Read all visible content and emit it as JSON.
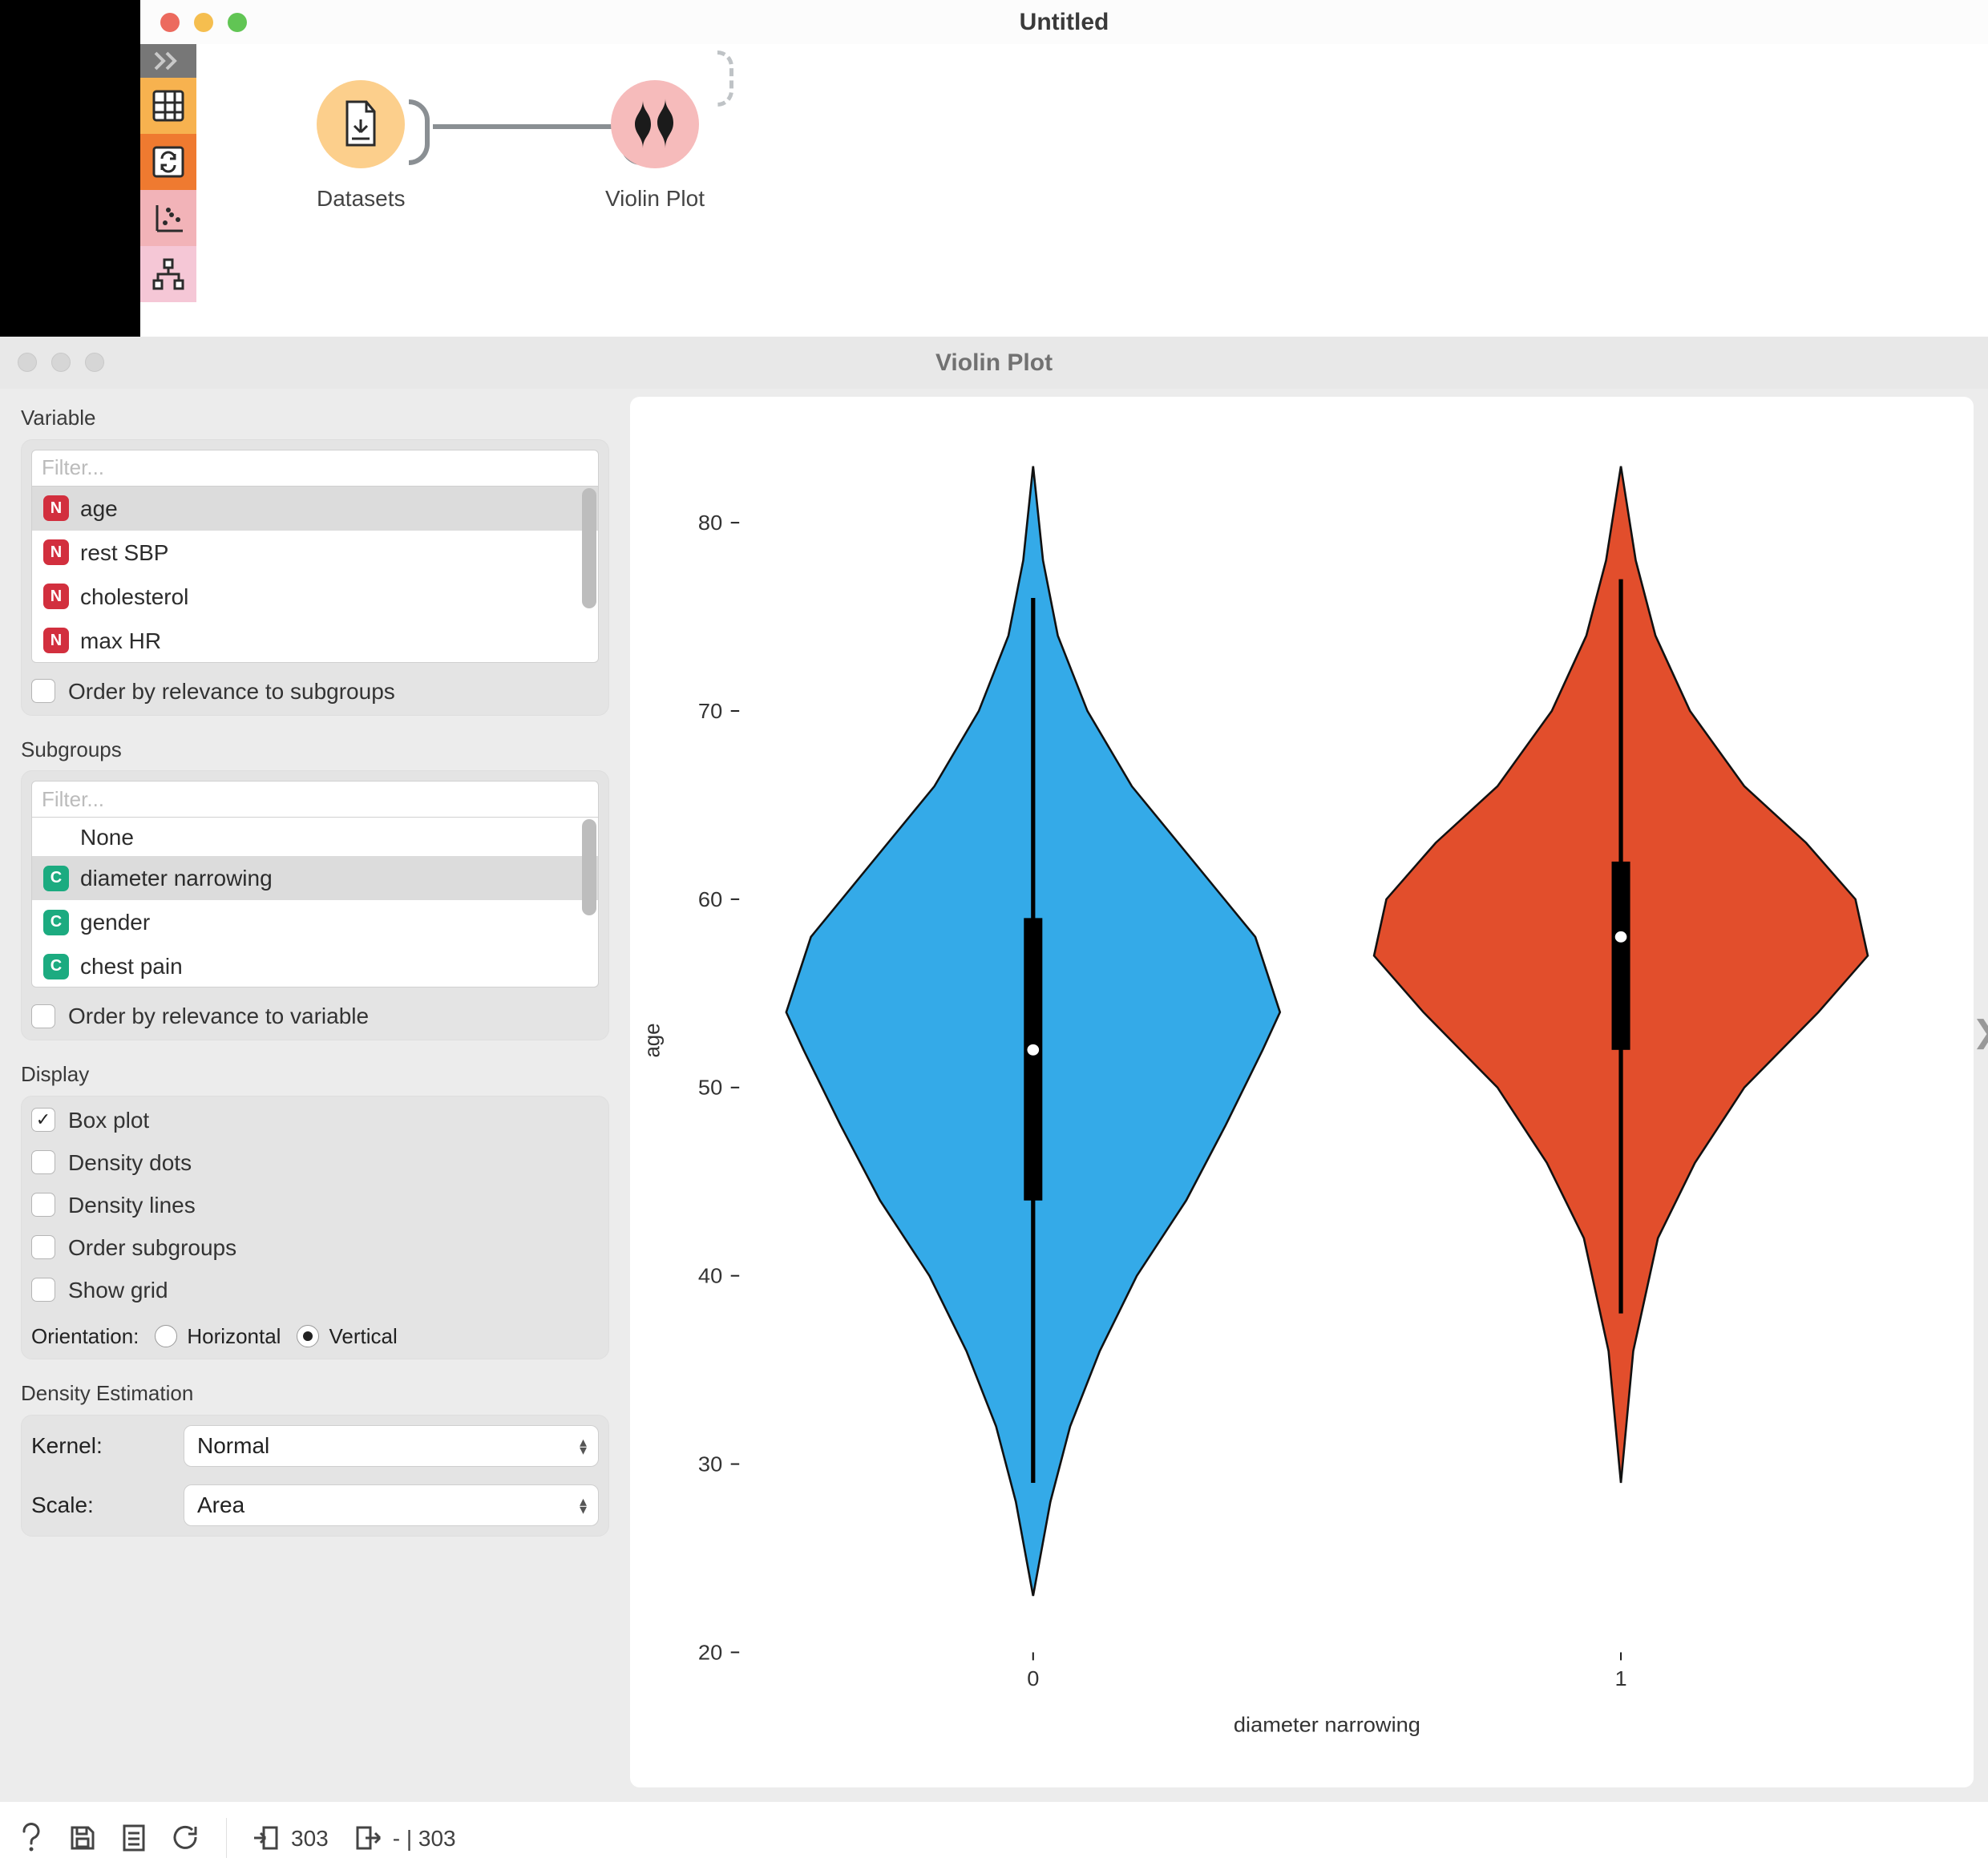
{
  "chart_data": {
    "type": "violin",
    "title": "",
    "xlabel": "diameter narrowing",
    "ylabel": "age",
    "ylim": [
      20,
      85
    ],
    "categories": [
      "0",
      "1"
    ],
    "series": [
      {
        "name": "0",
        "color": "#34aae8",
        "data_range": [
          23,
          83
        ],
        "box": {
          "whisker_low": 29,
          "q1": 44,
          "median": 52,
          "q3": 59,
          "whisker_high": 76
        },
        "density_profile": [
          [
            23,
            0
          ],
          [
            28,
            0.07
          ],
          [
            32,
            0.15
          ],
          [
            36,
            0.27
          ],
          [
            40,
            0.42
          ],
          [
            44,
            0.62
          ],
          [
            48,
            0.78
          ],
          [
            52,
            0.93
          ],
          [
            54,
            1.0
          ],
          [
            58,
            0.9
          ],
          [
            62,
            0.65
          ],
          [
            66,
            0.4
          ],
          [
            70,
            0.22
          ],
          [
            74,
            0.1
          ],
          [
            78,
            0.04
          ],
          [
            83,
            0
          ]
        ]
      },
      {
        "name": "1",
        "color": "#e24e2c",
        "data_range": [
          29,
          83
        ],
        "box": {
          "whisker_low": 38,
          "q1": 52,
          "median": 58,
          "q3": 62,
          "whisker_high": 77
        },
        "density_profile": [
          [
            29,
            0
          ],
          [
            36,
            0.05
          ],
          [
            42,
            0.15
          ],
          [
            46,
            0.3
          ],
          [
            50,
            0.5
          ],
          [
            54,
            0.8
          ],
          [
            57,
            1.0
          ],
          [
            60,
            0.95
          ],
          [
            63,
            0.75
          ],
          [
            66,
            0.5
          ],
          [
            70,
            0.28
          ],
          [
            74,
            0.14
          ],
          [
            78,
            0.06
          ],
          [
            83,
            0
          ]
        ]
      }
    ],
    "y_ticks": [
      20,
      30,
      40,
      50,
      60,
      70,
      80
    ]
  },
  "canvas": {
    "title": "Untitled",
    "nodes": {
      "datasets_label": "Datasets",
      "violin_label": "Violin Plot"
    }
  },
  "vp_window": {
    "title": "Violin Plot"
  },
  "panel": {
    "variable_label": "Variable",
    "variable_filter_placeholder": "Filter...",
    "variables": [
      {
        "kind": "N",
        "name": "age",
        "selected": true
      },
      {
        "kind": "N",
        "name": "rest SBP"
      },
      {
        "kind": "N",
        "name": "cholesterol"
      },
      {
        "kind": "N",
        "name": "max HR"
      }
    ],
    "variable_order_label": "Order by relevance to subgroups",
    "subgroups_label": "Subgroups",
    "subgroups_filter_placeholder": "Filter...",
    "subgroups": [
      {
        "kind": "",
        "name": "None"
      },
      {
        "kind": "C",
        "name": "diameter narrowing",
        "selected": true
      },
      {
        "kind": "C",
        "name": "gender"
      },
      {
        "kind": "C",
        "name": "chest pain"
      }
    ],
    "subgroup_order_label": "Order by relevance to variable",
    "display_label": "Display",
    "display_options": {
      "boxplot": {
        "label": "Box plot",
        "checked": true
      },
      "density_dots": {
        "label": "Density dots",
        "checked": false
      },
      "density_lines": {
        "label": "Density lines",
        "checked": false
      },
      "order_subgroups": {
        "label": "Order subgroups",
        "checked": false
      },
      "show_grid": {
        "label": "Show grid",
        "checked": false
      }
    },
    "orientation": {
      "label": "Orientation:",
      "horizontal": "Horizontal",
      "vertical": "Vertical",
      "value": "Vertical"
    },
    "density_est_label": "Density Estimation",
    "kernel": {
      "label": "Kernel:",
      "value": "Normal"
    },
    "scale": {
      "label": "Scale:",
      "value": "Area"
    }
  },
  "statusbar": {
    "in_count": "303",
    "out_count": "- | 303"
  }
}
